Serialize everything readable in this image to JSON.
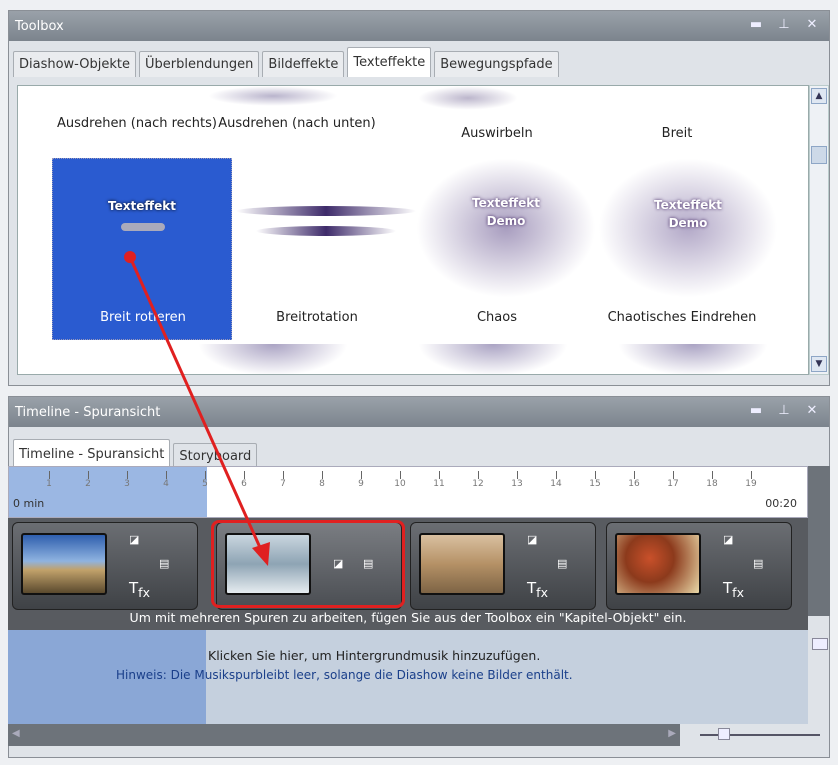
{
  "toolbox": {
    "title": "Toolbox",
    "tabs": [
      "Diashow-Objekte",
      "Überblendungen",
      "Bildeffekte",
      "Texteffekte",
      "Bewegungspfade"
    ],
    "row1": [
      "Ausdrehen (nach rechts)",
      "Ausdrehen (nach unten)",
      "Auswirbeln",
      "Breit"
    ],
    "row2": [
      "Breit rotieren",
      "Breitrotation",
      "Chaos",
      "Chaotisches Eindrehen"
    ],
    "preview_line1": "Texteffekt",
    "preview_line2": "Demo"
  },
  "timeline": {
    "title": "Timeline - Spuransicht",
    "tabs": [
      "Timeline - Spuransicht",
      "Storyboard"
    ],
    "ruler_start": "0 min",
    "ruler_end": "00:20",
    "ticks": [
      "1",
      "2",
      "3",
      "4",
      "5",
      "6",
      "7",
      "8",
      "9",
      "10",
      "11",
      "12",
      "13",
      "14",
      "15",
      "16",
      "17",
      "18",
      "19"
    ],
    "chapter_hint": "Um mit mehreren Spuren zu arbeiten, fügen Sie aus der Toolbox ein \"Kapitel-Objekt\" ein.",
    "music_line1": "Klicken Sie hier, um Hintergrundmusik hinzuzufügen.",
    "music_line2": "Hinweis: Die Musikspurbleibt leer, solange die Diashow keine Bilder enthält."
  },
  "colors": {
    "accent": "#2a5bd0",
    "highlight_red": "#e02020"
  },
  "icons": [
    "minimize-icon",
    "pin-icon",
    "close-icon",
    "text-effect-icon",
    "image-effect-icon",
    "caption-icon"
  ]
}
